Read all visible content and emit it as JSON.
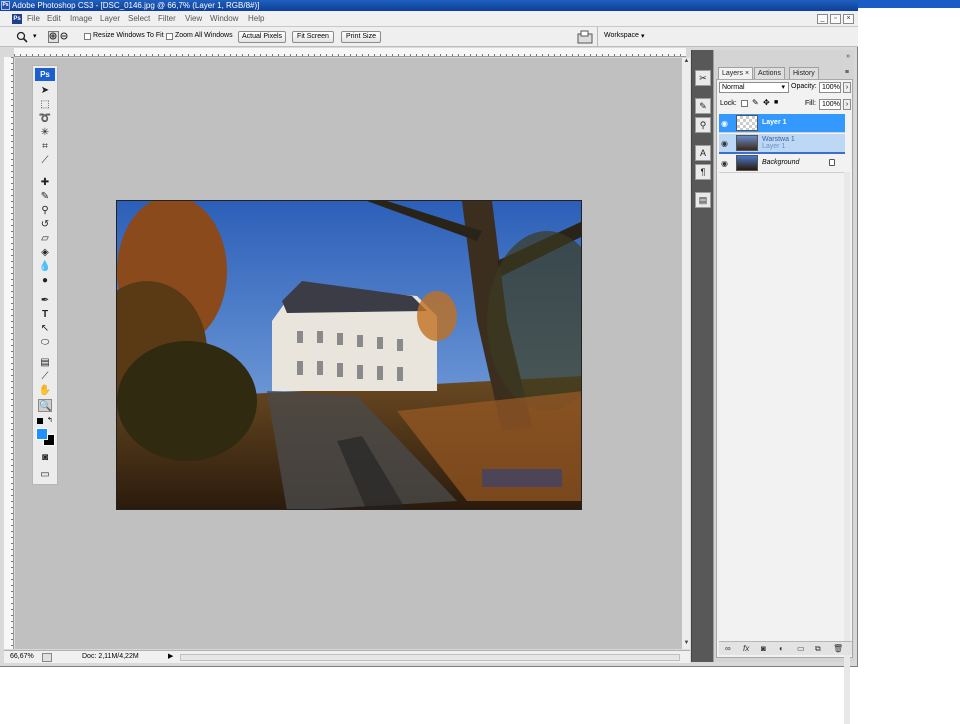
{
  "window": {
    "title": "Adobe Photoshop CS3 - [DSC_0146.jpg @ 66,7% (Layer 1, RGB/8#)]",
    "app_badge": "Ps",
    "ps_mini": "Ps"
  },
  "menu": {
    "items": [
      "File",
      "Edit",
      "Image",
      "Layer",
      "Select",
      "Filter",
      "View",
      "Window",
      "Help"
    ],
    "controls": {
      "minimize": "_",
      "restore": "▫",
      "close": "×"
    }
  },
  "options": {
    "dropdown_arrow": "▾",
    "resize_windows_label": "Resize Windows To Fit",
    "zoom_all_label": "Zoom All Windows",
    "actual_pixels_label": "Actual Pixels",
    "fit_screen_label": "Fit Screen",
    "print_size_label": "Print Size",
    "workspace_label": "Workspace",
    "workspace_arrow": "▾"
  },
  "status": {
    "zoom": "66,67%",
    "doc": "Doc: 2,11M/4,22M",
    "arrow": "▶"
  },
  "panel": {
    "tabs": [
      "Layers",
      "Actions",
      "History"
    ],
    "tab_close": "×",
    "blend_mode": "Normal",
    "blend_arrow": "▾",
    "opacity_label": "Opacity:",
    "opacity_value": "100%",
    "lock_label": "Lock:",
    "fill_label": "Fill:",
    "fill_value": "100%",
    "stepper_arrow": "›",
    "layers": [
      {
        "name": "Layer 1",
        "selected": true
      },
      {
        "name": "Warstwa 1",
        "selected": false,
        "dragging": true
      },
      {
        "name": "Background",
        "selected": false,
        "locked": true
      }
    ],
    "drag_ghost_label": "Layer 1",
    "eye_glyph": "◉",
    "lock_glyph": "🔒",
    "bottom_icons": [
      "link-icon",
      "fx-icon",
      "mask-icon",
      "adjustment-icon",
      "group-icon",
      "new-layer-icon",
      "trash-icon"
    ]
  },
  "colors": {
    "accent": "#3399ff",
    "title_blue": "#1b5bc6",
    "foreground": "#1e90ff",
    "background": "#000000"
  }
}
